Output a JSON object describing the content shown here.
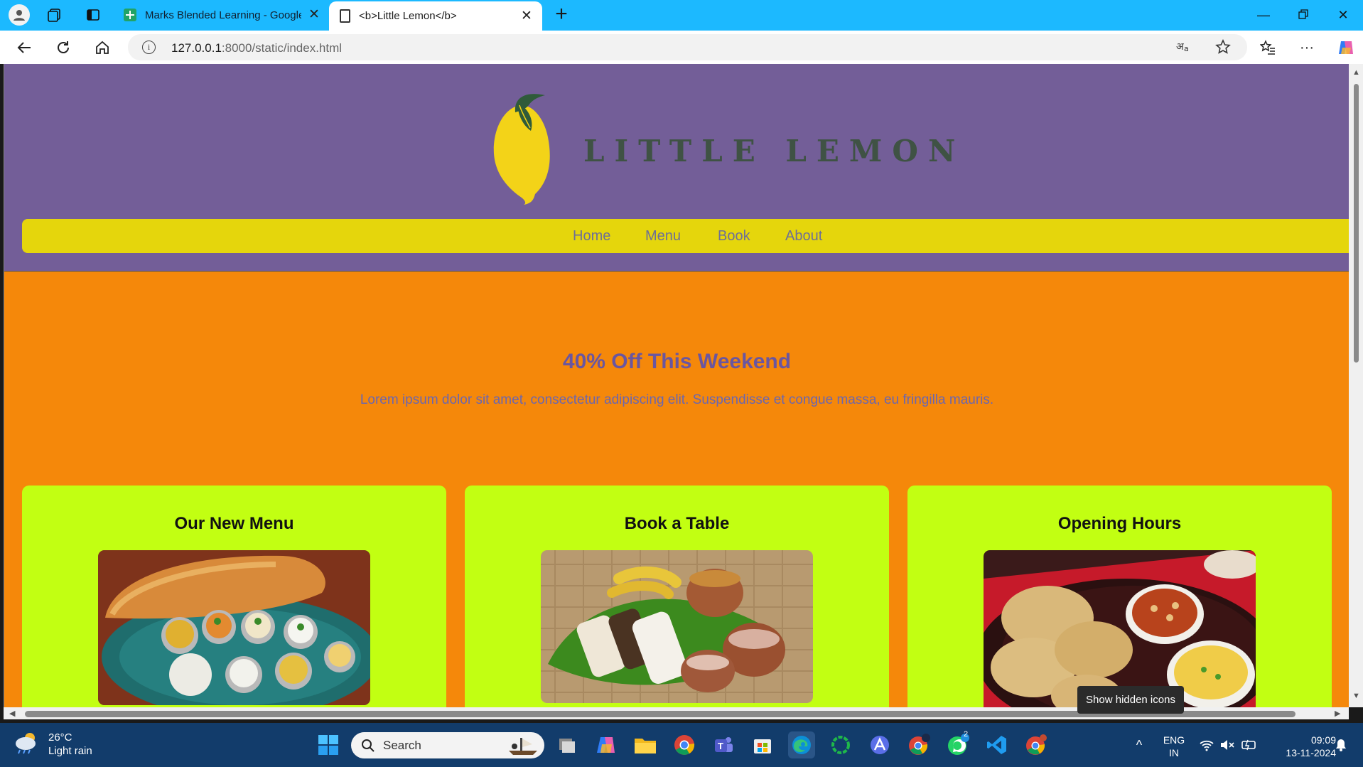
{
  "browser": {
    "tabs": [
      {
        "title": "Marks Blended Learning - Google"
      },
      {
        "title": "<b>Little Lemon</b>"
      }
    ],
    "address": {
      "host": "127.0.0.1",
      "path": ":8000/static/index.html"
    }
  },
  "site": {
    "brand": "LITTLE LEMON",
    "nav": [
      {
        "label": "Home"
      },
      {
        "label": "Menu"
      },
      {
        "label": "Book"
      },
      {
        "label": "About"
      }
    ],
    "hero": {
      "title": "40% Off This Weekend",
      "text": "Lorem ipsum dolor sit amet, consectetur adipiscing elit. Suspendisse et congue massa, eu fringilla mauris."
    },
    "cards": [
      {
        "title": "Our New Menu"
      },
      {
        "title": "Book a Table"
      },
      {
        "title": "Opening Hours"
      }
    ]
  },
  "tooltip": "Show hidden icons",
  "taskbar": {
    "weather": {
      "temp": "26°C",
      "condition": "Light rain"
    },
    "search_label": "Search",
    "lang": {
      "line1": "ENG",
      "line2": "IN"
    },
    "time": "09:09",
    "date": "13-11-2024",
    "badges": {
      "teams": "2"
    }
  },
  "colors": {
    "header_bg": "#735e98",
    "nav_bg": "#e5d60c",
    "page_bg": "#f5880a",
    "card_bg": "#c2ff12",
    "hero_title": "#6a56a0"
  }
}
